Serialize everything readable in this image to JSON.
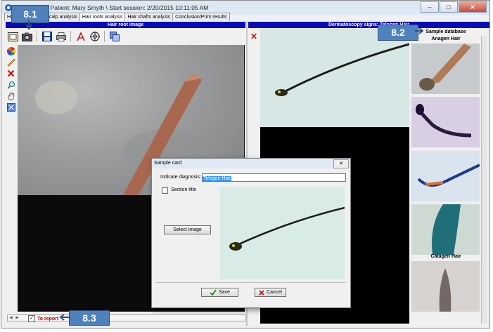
{
  "window": {
    "title": "Trichoscopy \\ Patient: Mary Smyth \\ Start session: 2/20/2015 10:11:05 AM",
    "controls": [
      "–",
      "□",
      "✕"
    ]
  },
  "tabs": [
    {
      "label": "Ha",
      "active": false
    },
    {
      "label": "ter",
      "active": false
    },
    {
      "label": "Scalp analysis",
      "active": false
    },
    {
      "label": "Hair roots analysis",
      "active": true
    },
    {
      "label": "Hair shafts analysis",
      "active": false
    },
    {
      "label": "Conclusion/Print results",
      "active": false
    }
  ],
  "left_panel": {
    "header": "Hair root image"
  },
  "right_panel": {
    "header": "Dermatoscopy signs: Telogen Hair"
  },
  "sample_database": {
    "header": "Sample database",
    "thumbnails": [
      "Anagen Hair",
      "",
      "",
      "Catagen Hair",
      ""
    ]
  },
  "report": {
    "label": "To report",
    "checked_mark": "✓"
  },
  "callouts": {
    "c1": "8.1",
    "c2": "8.2",
    "c3": "8.3"
  },
  "dialog": {
    "title": "Sample card",
    "diagnosis_label": "Indicate diagnosis:",
    "diagnosis_value": "Telogen Hair",
    "section_title_label": "Section title",
    "select_image_button": "Select image",
    "save_button": "Save",
    "cancel_button": "Cancel"
  },
  "colors": {
    "panel_header": "#0a0ab8",
    "callout": "#4f81bd",
    "report_label": "#c00000"
  }
}
